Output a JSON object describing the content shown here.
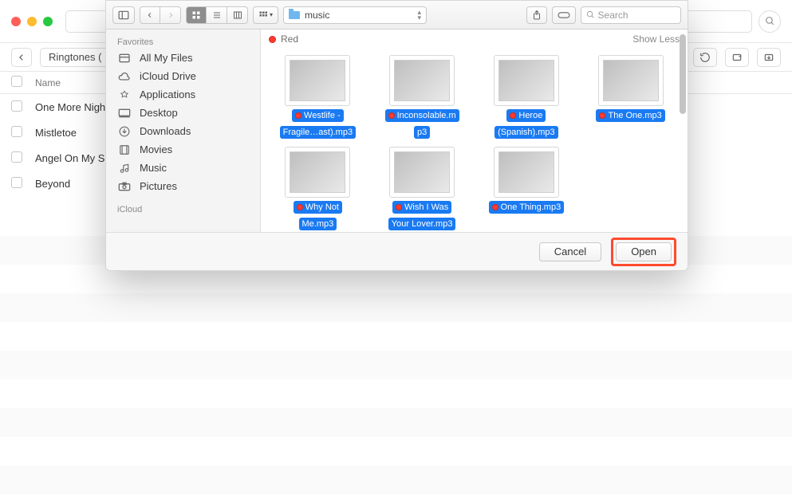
{
  "bg": {
    "breadcrumb_back": "Ringtones (",
    "table_header": "Name",
    "rows": [
      "One More Nigh",
      "Mistletoe",
      "Angel On My S",
      "Beyond"
    ]
  },
  "dialog": {
    "toolbar": {
      "path_label": "music",
      "search_placeholder": "Search"
    },
    "sidebar": {
      "sections": {
        "favorites_label": "Favorites",
        "icloud_label": "iCloud"
      },
      "items": [
        {
          "label": "All My Files"
        },
        {
          "label": "iCloud Drive"
        },
        {
          "label": "Applications"
        },
        {
          "label": "Desktop"
        },
        {
          "label": "Downloads"
        },
        {
          "label": "Movies"
        },
        {
          "label": "Music"
        },
        {
          "label": "Pictures"
        }
      ]
    },
    "main": {
      "tag_label": "Red",
      "show_less": "Show Less",
      "files": [
        {
          "line1": "Westlife -",
          "line2": "Fragile…ast).mp3"
        },
        {
          "line1": "Inconsolable.m",
          "line2": "p3"
        },
        {
          "line1": "Heroe",
          "line2": "(Spanish).mp3"
        },
        {
          "line1": "The One.mp3",
          "line2": ""
        },
        {
          "line1": "Why Not",
          "line2": "Me.mp3"
        },
        {
          "line1": "Wish I Was",
          "line2": "Your Lover.mp3"
        },
        {
          "line1": "One Thing.mp3",
          "line2": ""
        }
      ]
    },
    "footer": {
      "cancel": "Cancel",
      "open": "Open"
    }
  }
}
